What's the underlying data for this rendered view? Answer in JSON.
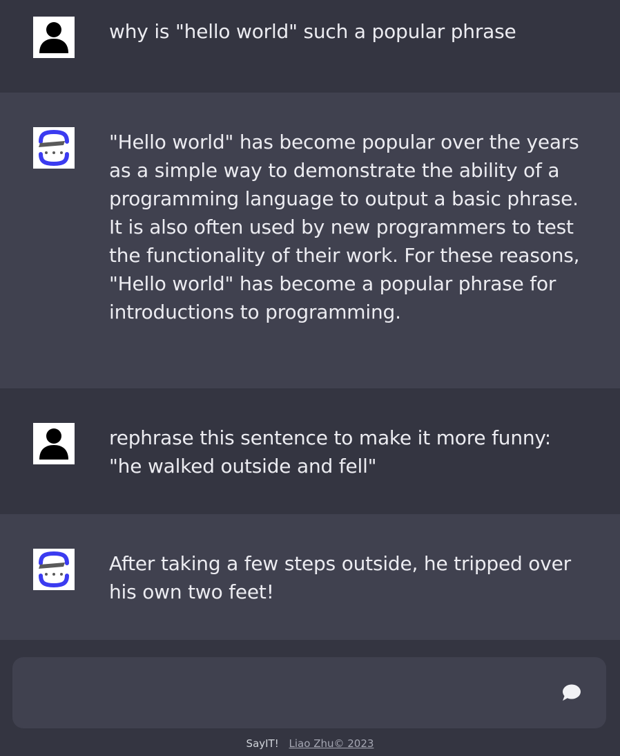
{
  "messages": [
    {
      "role": "user",
      "avatar": "person-icon",
      "text": "why is \"hello world\" such a popular phrase"
    },
    {
      "role": "assistant",
      "avatar": "sayit-logo-icon",
      "text": "\"Hello world\" has become popular over the years as a simple way to demonstrate the ability of a programming language to output a basic phrase. It is also often used by new programmers to test the functionality of their work. For these reasons, \"Hello world\" has become a popular phrase for introductions to programming."
    },
    {
      "role": "user",
      "avatar": "person-icon",
      "text": "rephrase this sentence to make it more funny: \"he walked outside and fell\""
    },
    {
      "role": "assistant",
      "avatar": "sayit-logo-icon",
      "text": "After taking a few steps outside, he tripped over his own two feet!"
    }
  ],
  "composer": {
    "value": "",
    "placeholder": "",
    "send_icon": "chat-bubble-icon"
  },
  "footer": {
    "app_name": "SayIT!",
    "author_link": "Liao Zhu© 2023"
  },
  "colors": {
    "user_bg": "#343541",
    "assistant_bg": "#40414f",
    "text": "#ececf1",
    "logo_blue": "#3b3bf0",
    "logo_gray": "#5a5a5a"
  }
}
